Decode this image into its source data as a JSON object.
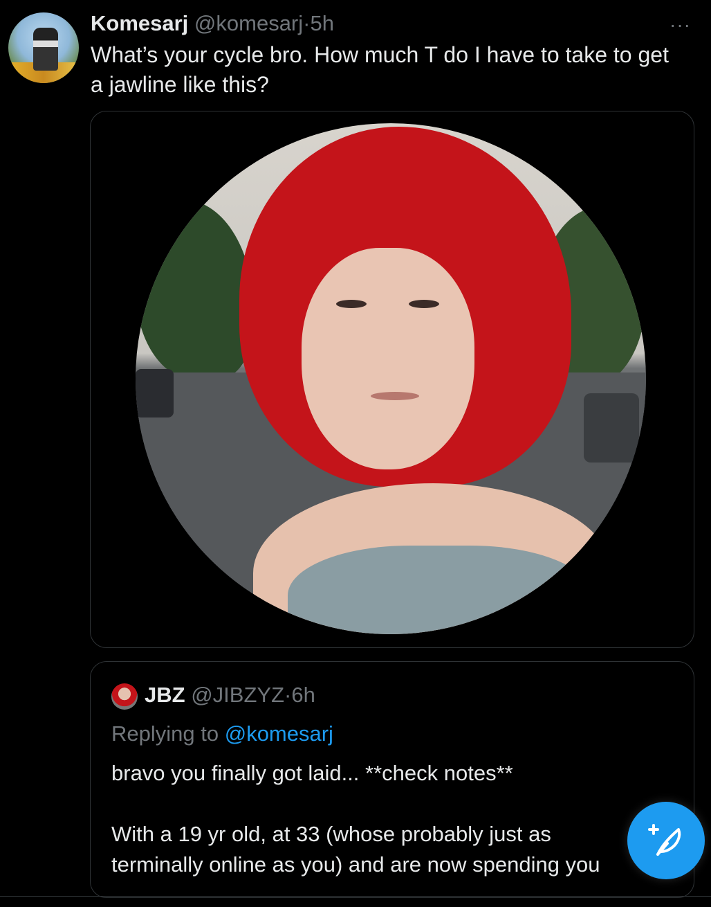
{
  "tweet": {
    "author_name": "Komesarj",
    "author_handle": "@komesarj",
    "separator": "·",
    "time": "5h",
    "more_label": "···",
    "text": "What’s your cycle bro. How much T do I have to take to get a jawline like this?"
  },
  "quoted": {
    "author_name": "JBZ",
    "author_handle": "@JIBZYZ",
    "separator": "·",
    "time": "6h",
    "replying_prefix": "Replying to",
    "replying_to": "@komesarj",
    "body_lines": [
      "bravo you finally got laid... **check notes**",
      "",
      "With a 19 yr old, at 33 (whose probably just as",
      "terminally online as you) and are now spending you"
    ]
  },
  "fab": {
    "icon": "compose-feather-plus-icon"
  },
  "colors": {
    "background": "#000000",
    "text": "#e7e9ea",
    "secondary": "#71767b",
    "accent": "#1d9bf0",
    "border": "#2f3336"
  }
}
